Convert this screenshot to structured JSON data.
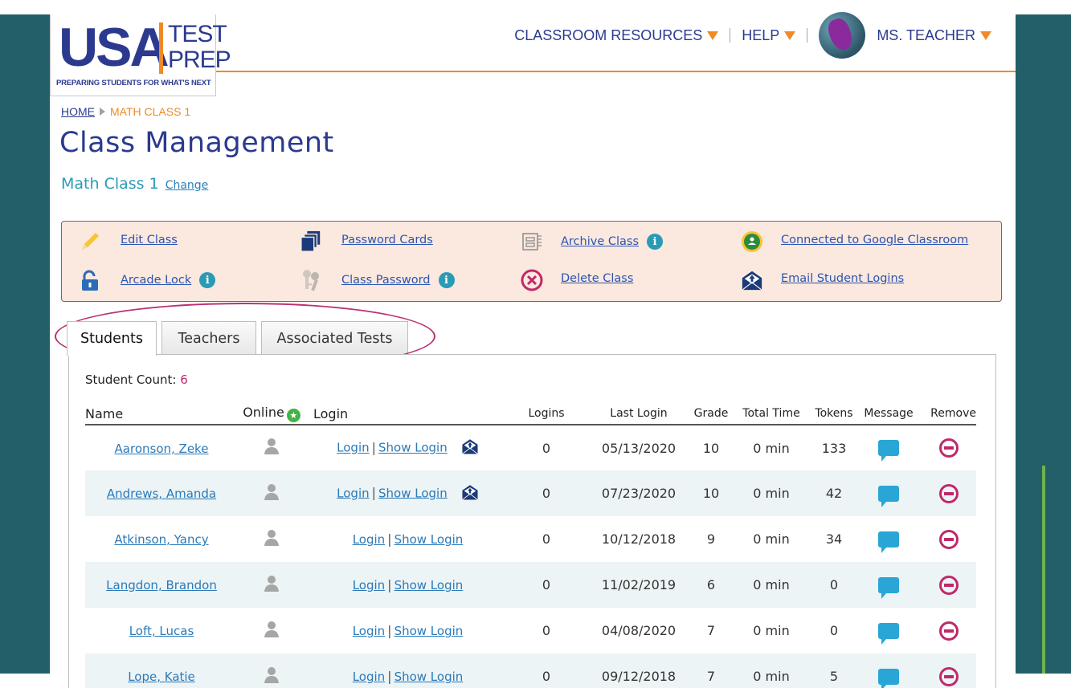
{
  "logo": {
    "usa": "USA",
    "test": "TEST",
    "prep": "PREP",
    "tagline": "PREPARING STUDENTS FOR WHAT'S NEXT"
  },
  "nav": {
    "resources": "CLASSROOM RESOURCES",
    "help": "HELP",
    "user": "MS. TEACHER"
  },
  "breadcrumb": {
    "home": "HOME",
    "current": "MATH CLASS 1"
  },
  "page_title": "Class Management",
  "class": {
    "name": "Math Class 1",
    "change": "Change"
  },
  "actions": {
    "edit_class": "Edit Class",
    "password_cards": "Password Cards",
    "archive_class": "Archive Class",
    "google_classroom": "Connected to Google Classroom",
    "arcade_lock": "Arcade Lock",
    "class_password": "Class Password",
    "delete_class": "Delete Class",
    "email_logins": "Email Student Logins",
    "info": "i"
  },
  "tabs": {
    "students": "Students",
    "teachers": "Teachers",
    "tests": "Associated Tests"
  },
  "student_count": {
    "label": "Student Count:",
    "value": "6"
  },
  "columns": {
    "name": "Name",
    "online": "Online",
    "login": "Login",
    "logins": "Logins",
    "last_login": "Last Login",
    "grade": "Grade",
    "total_time": "Total Time",
    "tokens": "Tokens",
    "message": "Message",
    "remove": "Remove"
  },
  "login_link": "Login",
  "show_login_link": "Show Login",
  "login_sep": "|",
  "students": [
    {
      "name": "Aaronson, Zeke",
      "logins": "0",
      "last_login": "05/13/2020",
      "grade": "10",
      "total_time": "0 min",
      "tokens": "133",
      "email_icon": true
    },
    {
      "name": "Andrews, Amanda",
      "logins": "0",
      "last_login": "07/23/2020",
      "grade": "10",
      "total_time": "0 min",
      "tokens": "42",
      "email_icon": true
    },
    {
      "name": "Atkinson, Yancy",
      "logins": "0",
      "last_login": "10/12/2018",
      "grade": "9",
      "total_time": "0 min",
      "tokens": "34",
      "email_icon": false
    },
    {
      "name": "Langdon, Brandon",
      "logins": "0",
      "last_login": "11/02/2019",
      "grade": "6",
      "total_time": "0 min",
      "tokens": "0",
      "email_icon": false
    },
    {
      "name": "Loft, Lucas",
      "logins": "0",
      "last_login": "04/08/2020",
      "grade": "7",
      "total_time": "0 min",
      "tokens": "0",
      "email_icon": false
    },
    {
      "name": "Lope, Katie",
      "logins": "0",
      "last_login": "09/12/2018",
      "grade": "7",
      "total_time": "0 min",
      "tokens": "5",
      "email_icon": false
    }
  ],
  "colors": {
    "navy": "#2b3a8f",
    "orange": "#f08a24",
    "teal": "#235f68",
    "accent_pink": "#c0286a"
  }
}
